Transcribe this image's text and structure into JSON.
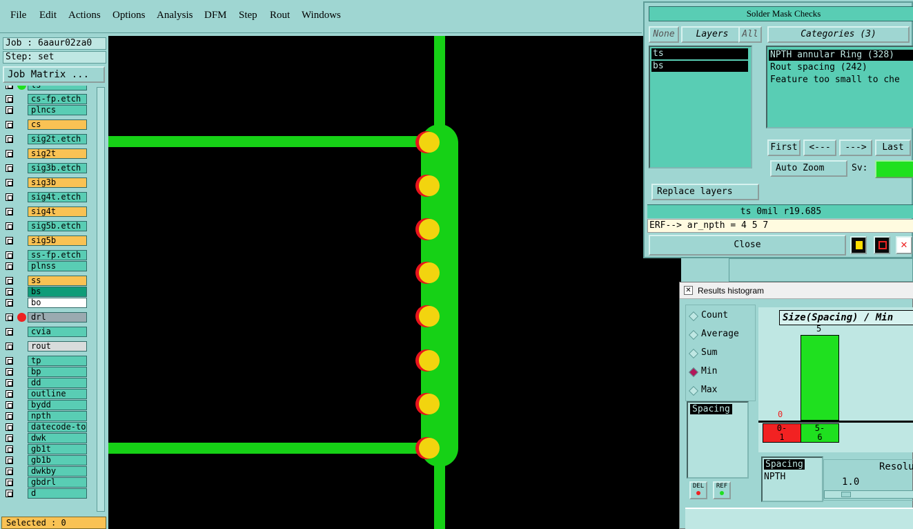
{
  "menu": [
    {
      "label": "File"
    },
    {
      "label": "Edit"
    },
    {
      "label": "Actions"
    },
    {
      "label": "Options"
    },
    {
      "label": "Analysis"
    },
    {
      "label": "DFM"
    },
    {
      "label": "Step"
    },
    {
      "label": "Rout"
    },
    {
      "label": "Windows"
    }
  ],
  "left": {
    "job": "Job : 6aaur02za0",
    "step": "Step: set",
    "job_matrix": "Job Matrix ...",
    "selected": "Selected : 0",
    "layers": [
      {
        "name": "ts",
        "color": "#59cdb4"
      },
      {
        "name": "cs-fp.etch",
        "color": "#59cdb4"
      },
      {
        "name": "plncs",
        "color": "#59cdb4"
      },
      {
        "name": "cs",
        "color": "#f9c254"
      },
      {
        "name": "sig2t.etch",
        "color": "#59cdb4"
      },
      {
        "name": "sig2t",
        "color": "#f9c254"
      },
      {
        "name": "sig3b.etch",
        "color": "#59cdb4"
      },
      {
        "name": "sig3b",
        "color": "#f9c254"
      },
      {
        "name": "sig4t.etch",
        "color": "#59cdb4"
      },
      {
        "name": "sig4t",
        "color": "#f9c254"
      },
      {
        "name": "sig5b.etch",
        "color": "#59cdb4"
      },
      {
        "name": "sig5b",
        "color": "#f9c254"
      },
      {
        "name": "ss-fp.etch",
        "color": "#59cdb4"
      },
      {
        "name": "plnss",
        "color": "#59cdb4"
      },
      {
        "name": "ss",
        "color": "#f9c254"
      },
      {
        "name": "bs",
        "color": "#0f9c78"
      },
      {
        "name": "bo",
        "color": "#ffffff"
      },
      {
        "name": "drl",
        "color": "#9aaab0"
      },
      {
        "name": "cvia",
        "color": "#59cdb4"
      },
      {
        "name": "rout",
        "color": "#d8dcdc"
      },
      {
        "name": "tp",
        "color": "#59cdb4"
      },
      {
        "name": "bp",
        "color": "#59cdb4"
      },
      {
        "name": "dd",
        "color": "#59cdb4"
      },
      {
        "name": "outline",
        "color": "#59cdb4"
      },
      {
        "name": "bydd",
        "color": "#59cdb4"
      },
      {
        "name": "npth",
        "color": "#59cdb4"
      },
      {
        "name": "datecode-to",
        "color": "#59cdb4"
      },
      {
        "name": "dwk",
        "color": "#59cdb4"
      },
      {
        "name": "gb1t",
        "color": "#59cdb4"
      },
      {
        "name": "gb1b",
        "color": "#59cdb4"
      },
      {
        "name": "dwkby",
        "color": "#59cdb4"
      },
      {
        "name": "gbdrl",
        "color": "#59cdb4"
      },
      {
        "name": "d",
        "color": "#59cdb4"
      }
    ]
  },
  "solder_mask": {
    "title": "Solder Mask Checks",
    "none": "None",
    "layers_label": "Layers",
    "all": "All",
    "categories": "Categories (3)",
    "layer_items": [
      "ts",
      "bs"
    ],
    "category_items": [
      "NPTH annular Ring (328)",
      "Rout spacing (242)",
      "Feature too small to che"
    ],
    "first": "First",
    "prev": "<---",
    "next": "--->",
    "last": "Last",
    "auto_zoom": "Auto Zoom",
    "sv": "Sv:",
    "replace_layers": "Replace layers",
    "status": "ts 0mil  r19.685",
    "erf": "ERF--> ar_npth = 4 5 7",
    "close": "Close"
  },
  "histogram": {
    "title": "Results histogram",
    "header": "Size(Spacing) / Min",
    "modes": [
      "Count",
      "Average",
      "Sum",
      "Min",
      "Max"
    ],
    "selected_mode": "Min",
    "list_item": "Spacing",
    "del": "DEL",
    "ref": "REF",
    "bottom_items": [
      "Spacing",
      "NPTH"
    ],
    "resolution_label": "Resolu",
    "resolution_value": "1.0",
    "bars": [
      {
        "label": "0-\n1",
        "value": "0",
        "color": "#f22222"
      },
      {
        "label": "5-\n6",
        "value": "5",
        "color": "#1fe01f"
      }
    ]
  }
}
